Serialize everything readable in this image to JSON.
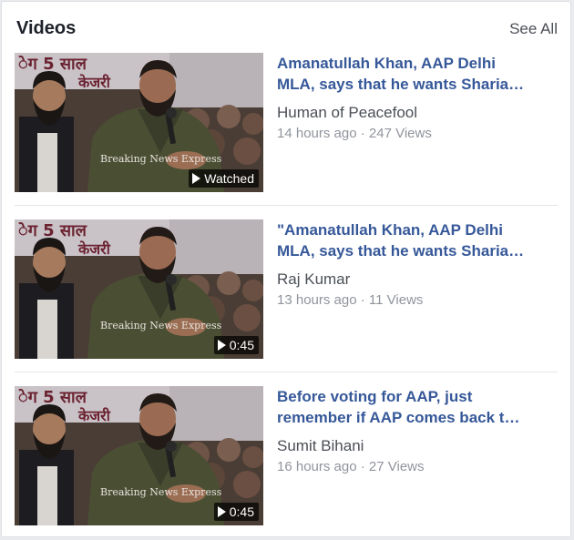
{
  "header": {
    "title": "Videos",
    "see_all": "See All"
  },
  "videos": [
    {
      "title_lines": [
        "Amanatullah Khan, AAP Delhi",
        "MLA, says that he wants Sharia…"
      ],
      "author": "Human of Peacefool",
      "time": "14 hours ago",
      "separator": "·",
      "views": "247 Views",
      "badge": "Watched",
      "thumb_text": "Breaking News Express",
      "banner_text_1": "ेग 5 साल",
      "banner_text_2": "केजरी"
    },
    {
      "title_lines": [
        "\"Amanatullah Khan, AAP Delhi",
        "MLA, says that he wants Sharia…"
      ],
      "author": "Raj Kumar",
      "time": "13 hours ago",
      "separator": "·",
      "views": "11 Views",
      "badge": "0:45",
      "thumb_text": "Breaking News Express",
      "banner_text_1": "ेग 5 साल",
      "banner_text_2": "केजरी"
    },
    {
      "title_lines": [
        "Before voting for AAP, just",
        "remember if AAP comes back t…"
      ],
      "author": "Sumit Bihani",
      "time": "16 hours ago",
      "separator": "·",
      "views": "27 Views",
      "badge": "0:45",
      "thumb_text": "Breaking News Express",
      "banner_text_1": "ेग 5 साल",
      "banner_text_2": "केजरी"
    }
  ],
  "colors": {
    "link": "#365899",
    "muted": "#90949c",
    "text": "#1d2129"
  }
}
